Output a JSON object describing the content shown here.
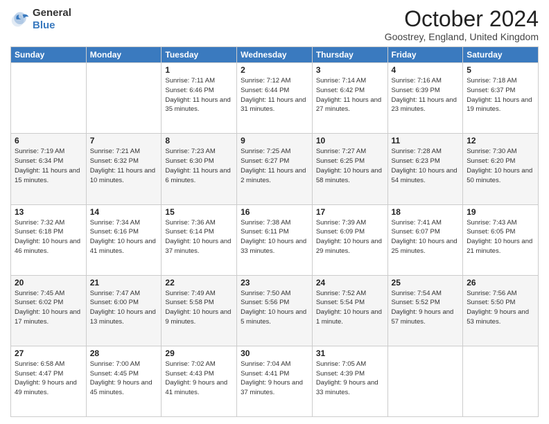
{
  "logo": {
    "general": "General",
    "blue": "Blue"
  },
  "header": {
    "month": "October 2024",
    "location": "Goostrey, England, United Kingdom"
  },
  "days_of_week": [
    "Sunday",
    "Monday",
    "Tuesday",
    "Wednesday",
    "Thursday",
    "Friday",
    "Saturday"
  ],
  "weeks": [
    [
      {
        "day": null,
        "info": null
      },
      {
        "day": null,
        "info": null
      },
      {
        "day": "1",
        "info": "Sunrise: 7:11 AM\nSunset: 6:46 PM\nDaylight: 11 hours and 35 minutes."
      },
      {
        "day": "2",
        "info": "Sunrise: 7:12 AM\nSunset: 6:44 PM\nDaylight: 11 hours and 31 minutes."
      },
      {
        "day": "3",
        "info": "Sunrise: 7:14 AM\nSunset: 6:42 PM\nDaylight: 11 hours and 27 minutes."
      },
      {
        "day": "4",
        "info": "Sunrise: 7:16 AM\nSunset: 6:39 PM\nDaylight: 11 hours and 23 minutes."
      },
      {
        "day": "5",
        "info": "Sunrise: 7:18 AM\nSunset: 6:37 PM\nDaylight: 11 hours and 19 minutes."
      }
    ],
    [
      {
        "day": "6",
        "info": "Sunrise: 7:19 AM\nSunset: 6:34 PM\nDaylight: 11 hours and 15 minutes."
      },
      {
        "day": "7",
        "info": "Sunrise: 7:21 AM\nSunset: 6:32 PM\nDaylight: 11 hours and 10 minutes."
      },
      {
        "day": "8",
        "info": "Sunrise: 7:23 AM\nSunset: 6:30 PM\nDaylight: 11 hours and 6 minutes."
      },
      {
        "day": "9",
        "info": "Sunrise: 7:25 AM\nSunset: 6:27 PM\nDaylight: 11 hours and 2 minutes."
      },
      {
        "day": "10",
        "info": "Sunrise: 7:27 AM\nSunset: 6:25 PM\nDaylight: 10 hours and 58 minutes."
      },
      {
        "day": "11",
        "info": "Sunrise: 7:28 AM\nSunset: 6:23 PM\nDaylight: 10 hours and 54 minutes."
      },
      {
        "day": "12",
        "info": "Sunrise: 7:30 AM\nSunset: 6:20 PM\nDaylight: 10 hours and 50 minutes."
      }
    ],
    [
      {
        "day": "13",
        "info": "Sunrise: 7:32 AM\nSunset: 6:18 PM\nDaylight: 10 hours and 46 minutes."
      },
      {
        "day": "14",
        "info": "Sunrise: 7:34 AM\nSunset: 6:16 PM\nDaylight: 10 hours and 41 minutes."
      },
      {
        "day": "15",
        "info": "Sunrise: 7:36 AM\nSunset: 6:14 PM\nDaylight: 10 hours and 37 minutes."
      },
      {
        "day": "16",
        "info": "Sunrise: 7:38 AM\nSunset: 6:11 PM\nDaylight: 10 hours and 33 minutes."
      },
      {
        "day": "17",
        "info": "Sunrise: 7:39 AM\nSunset: 6:09 PM\nDaylight: 10 hours and 29 minutes."
      },
      {
        "day": "18",
        "info": "Sunrise: 7:41 AM\nSunset: 6:07 PM\nDaylight: 10 hours and 25 minutes."
      },
      {
        "day": "19",
        "info": "Sunrise: 7:43 AM\nSunset: 6:05 PM\nDaylight: 10 hours and 21 minutes."
      }
    ],
    [
      {
        "day": "20",
        "info": "Sunrise: 7:45 AM\nSunset: 6:02 PM\nDaylight: 10 hours and 17 minutes."
      },
      {
        "day": "21",
        "info": "Sunrise: 7:47 AM\nSunset: 6:00 PM\nDaylight: 10 hours and 13 minutes."
      },
      {
        "day": "22",
        "info": "Sunrise: 7:49 AM\nSunset: 5:58 PM\nDaylight: 10 hours and 9 minutes."
      },
      {
        "day": "23",
        "info": "Sunrise: 7:50 AM\nSunset: 5:56 PM\nDaylight: 10 hours and 5 minutes."
      },
      {
        "day": "24",
        "info": "Sunrise: 7:52 AM\nSunset: 5:54 PM\nDaylight: 10 hours and 1 minute."
      },
      {
        "day": "25",
        "info": "Sunrise: 7:54 AM\nSunset: 5:52 PM\nDaylight: 9 hours and 57 minutes."
      },
      {
        "day": "26",
        "info": "Sunrise: 7:56 AM\nSunset: 5:50 PM\nDaylight: 9 hours and 53 minutes."
      }
    ],
    [
      {
        "day": "27",
        "info": "Sunrise: 6:58 AM\nSunset: 4:47 PM\nDaylight: 9 hours and 49 minutes."
      },
      {
        "day": "28",
        "info": "Sunrise: 7:00 AM\nSunset: 4:45 PM\nDaylight: 9 hours and 45 minutes."
      },
      {
        "day": "29",
        "info": "Sunrise: 7:02 AM\nSunset: 4:43 PM\nDaylight: 9 hours and 41 minutes."
      },
      {
        "day": "30",
        "info": "Sunrise: 7:04 AM\nSunset: 4:41 PM\nDaylight: 9 hours and 37 minutes."
      },
      {
        "day": "31",
        "info": "Sunrise: 7:05 AM\nSunset: 4:39 PM\nDaylight: 9 hours and 33 minutes."
      },
      {
        "day": null,
        "info": null
      },
      {
        "day": null,
        "info": null
      }
    ]
  ]
}
